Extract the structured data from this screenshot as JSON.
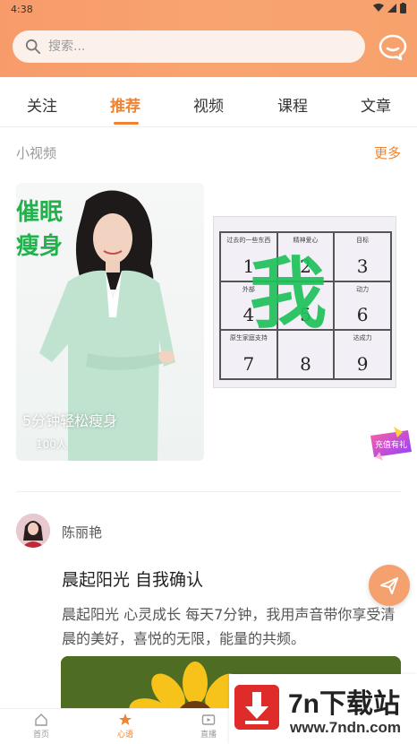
{
  "status": {
    "time": "4:38"
  },
  "search": {
    "placeholder": "搜索..."
  },
  "tabs": [
    {
      "label": "关注"
    },
    {
      "label": "推荐",
      "active": true
    },
    {
      "label": "视频"
    },
    {
      "label": "课程"
    },
    {
      "label": "文章"
    }
  ],
  "short_video": {
    "title": "小视频",
    "more": "更多",
    "items": [
      {
        "overlay_title": "催眠\n瘦身",
        "caption": "5分钟轻松瘦身",
        "views": "100人"
      },
      {
        "big_char": "我",
        "grid": [
          {
            "label": "过去的一些东西",
            "num": "1"
          },
          {
            "label": "精神爱心",
            "num": "2"
          },
          {
            "label": "目标",
            "num": "3"
          },
          {
            "label": "外部",
            "num": "4"
          },
          {
            "label": "",
            "num": "5"
          },
          {
            "label": "动力",
            "num": "6"
          },
          {
            "label": "原生家庭支持",
            "num": "7"
          },
          {
            "label": "",
            "num": "8"
          },
          {
            "label": "达成力",
            "num": "9"
          }
        ]
      }
    ],
    "gift_label": "充值有礼"
  },
  "post": {
    "author": "陈丽艳",
    "title": "晨起阳光 自我确认",
    "body": "晨起阳光 心灵成长 每天7分钟，我用声音带你享受清晨的美好，喜悦的无限，能量的共频。"
  },
  "bottom_nav": [
    {
      "label": "首页"
    },
    {
      "label": "心语",
      "active": true
    },
    {
      "label": "直播"
    }
  ],
  "watermark": {
    "name": "7n下载站",
    "url": "www.7ndn.com"
  },
  "colors": {
    "accent": "#f0832f",
    "header": "#f9a46f",
    "green": "#22b14c"
  }
}
